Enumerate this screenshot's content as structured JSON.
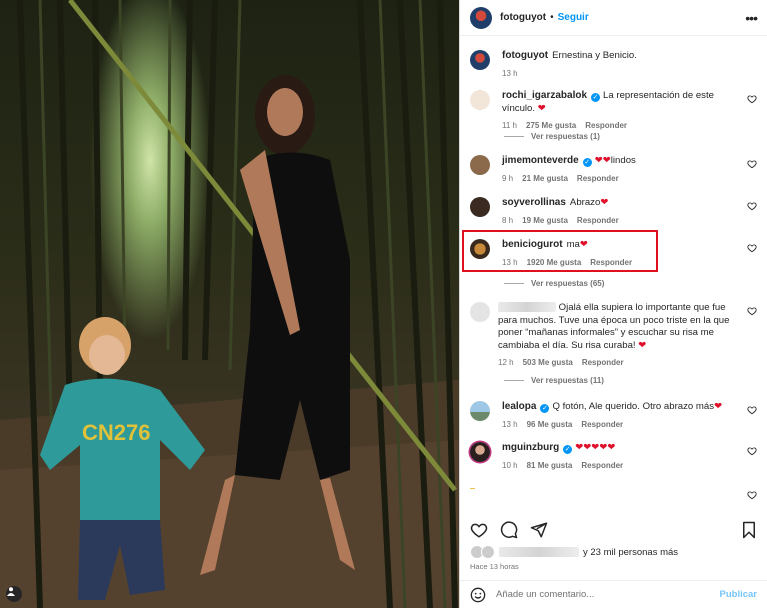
{
  "post": {
    "author": "fotoguyot",
    "follow_label": "Seguir",
    "separator": "•",
    "caption": "Ernestina y Benicio.",
    "caption_time": "13 h"
  },
  "comments": [
    {
      "user": "rochi_igarzabalok",
      "verified": true,
      "text": "La representación de este vínculo.",
      "heart": "❤",
      "time": "11 h",
      "likes": "275 Me gusta",
      "reply": "Responder"
    },
    {
      "user": "jimemonteverde",
      "verified": true,
      "text": "",
      "heart": "❤❤",
      "tail": "lindos",
      "time": "9 h",
      "likes": "21 Me gusta",
      "reply": "Responder"
    },
    {
      "user": "soyverollinas",
      "verified": false,
      "text": "Abrazo",
      "heart": "❤",
      "time": "8 h",
      "likes": "19 Me gusta",
      "reply": "Responder"
    },
    {
      "user": "beniciogurot",
      "verified": false,
      "text": "ma",
      "heart": "❤",
      "time": "13 h",
      "likes": "1920 Me gusta",
      "reply": "Responder"
    },
    {
      "user": "",
      "verified": false,
      "text": "Ojalá ella supiera lo importante que fue para muchos. Tuve una época un poco triste en la que poner “mañanas informales” y escuchar su risa me cambiaba el día. Su risa curaba!",
      "heart": "❤",
      "time": "12 h",
      "likes": "503 Me gusta",
      "reply": "Responder"
    },
    {
      "user": "lealopa",
      "verified": true,
      "text": "Q fotón, Ale querido. Otro abrazo más",
      "heart": "❤",
      "time": "13 h",
      "likes": "96 Me gusta",
      "reply": "Responder"
    },
    {
      "user": "mguinzburg",
      "verified": true,
      "text": "",
      "heart": "❤❤❤❤❤",
      "time": "10 h",
      "likes": "81 Me gusta",
      "reply": "Responder"
    }
  ],
  "view_replies": [
    {
      "label": "Ver respuestas (1)"
    },
    {
      "label": "Ver respuestas (65)"
    },
    {
      "label": "Ver respuestas (11)"
    }
  ],
  "likes_summary": "y 23 mil personas más",
  "likes_prefix": "hilti",
  "time_ago": "Hace 13 horas",
  "comment_box": {
    "placeholder": "Añade un comentario...",
    "publish_label": "Publicar"
  },
  "colors": {
    "accent": "#0095f6",
    "highlight": "#e0101f",
    "heart": "#e0102b"
  },
  "icons": [
    "more-icon",
    "heart-icon",
    "comment-icon",
    "share-icon",
    "save-icon",
    "emoji-icon",
    "user-tag-icon"
  ]
}
